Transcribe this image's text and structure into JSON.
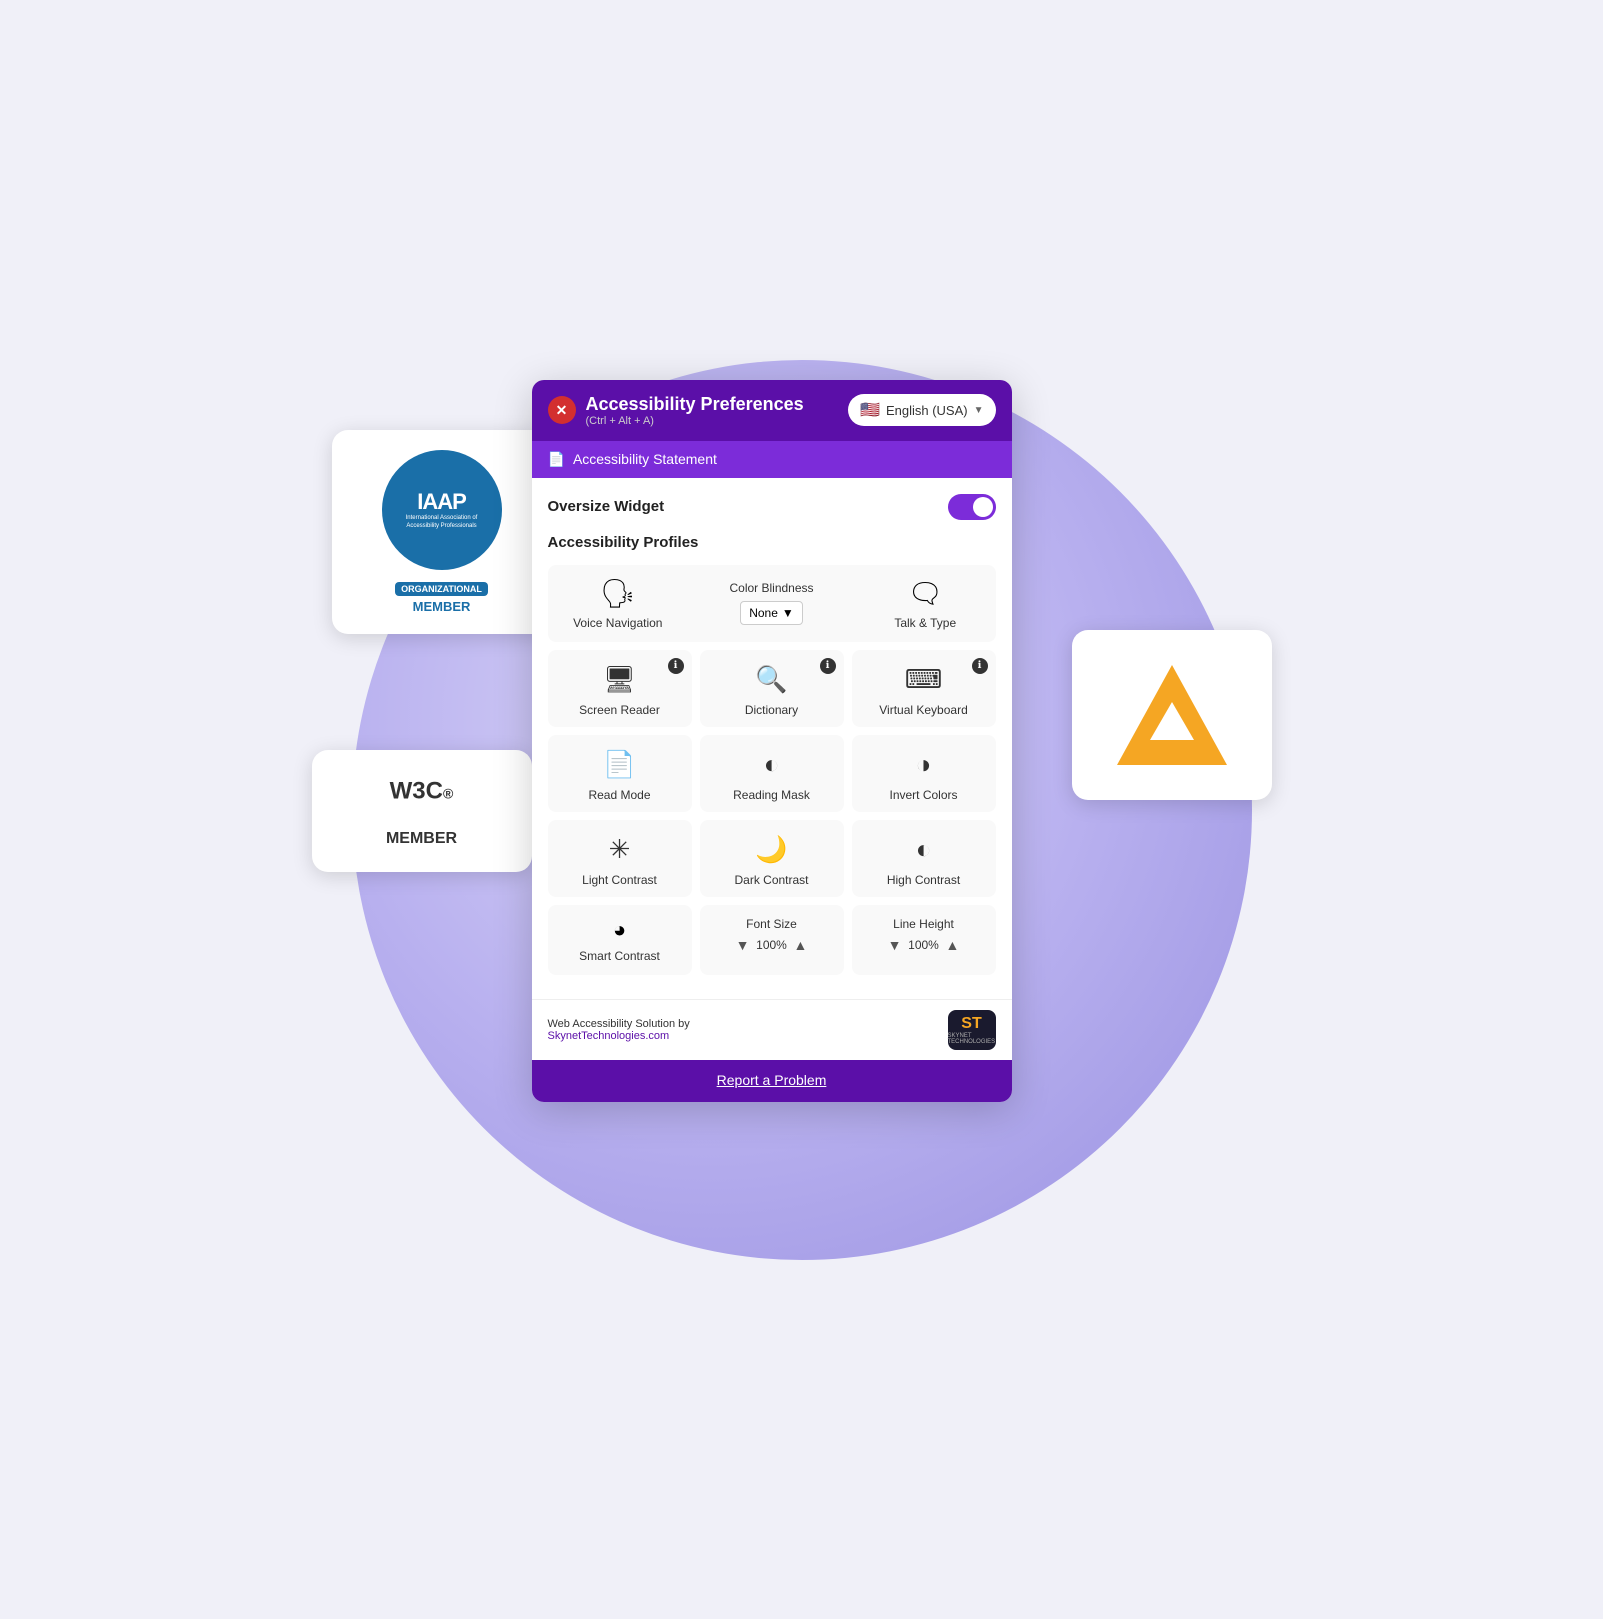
{
  "scene": {
    "circle": true
  },
  "iaap": {
    "title": "IAAP",
    "subtitle": "International Association of Accessibility Professionals",
    "org_label": "ORGANIZATIONAL",
    "member_label": "MEMBER"
  },
  "w3c": {
    "logo": "W3C",
    "registered": "®",
    "member": "MEMBER"
  },
  "panel": {
    "close_label": "✕",
    "title": "Accessibility Preferences",
    "shortcut": "(Ctrl + Alt + A)",
    "language": "English (USA)",
    "flag": "🇺🇸",
    "accessibility_statement": "Accessibility Statement",
    "oversize_widget_label": "Oversize Widget",
    "accessibility_profiles_label": "Accessibility Profiles",
    "voice_navigation_label": "Voice Navigation",
    "color_blindness_label": "Color Blindness",
    "color_blindness_value": "None",
    "talk_type_label": "Talk & Type",
    "screen_reader_label": "Screen Reader",
    "dictionary_label": "Dictionary",
    "virtual_keyboard_label": "Virtual Keyboard",
    "read_mode_label": "Read Mode",
    "reading_mask_label": "Reading Mask",
    "invert_colors_label": "Invert Colors",
    "light_contrast_label": "Light Contrast",
    "dark_contrast_label": "Dark Contrast",
    "high_contrast_label": "High Contrast",
    "smart_contrast_label": "Smart Contrast",
    "font_size_label": "Font Size",
    "font_size_value": "100%",
    "line_height_label": "Line Height",
    "line_height_value": "100%",
    "footer_text": "Web Accessibility Solution by",
    "footer_link": "SkynetTechnologies.com",
    "report_problem": "Report a Problem",
    "skynet_label": "ST"
  }
}
